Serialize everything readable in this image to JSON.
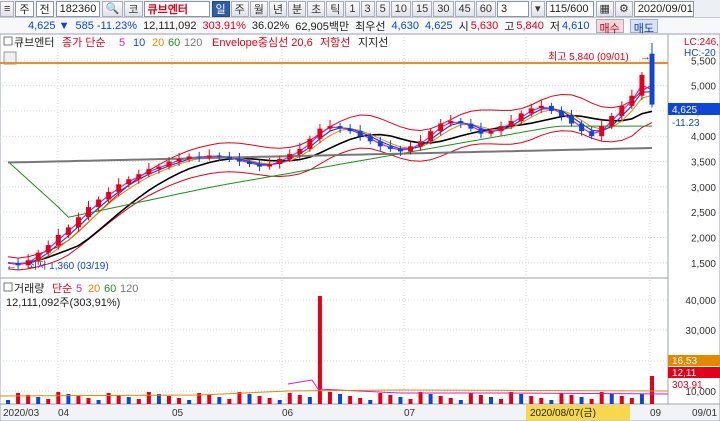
{
  "toolbar": {
    "market": "주",
    "period": "전",
    "code": "182360",
    "code_prefix": "코",
    "name": "큐브엔터",
    "tabs": [
      "일",
      "주",
      "월",
      "년",
      "분",
      "초",
      "틱"
    ],
    "active_tab": "일",
    "intervals": [
      "1",
      "3",
      "5",
      "10",
      "15",
      "30",
      "45",
      "60"
    ],
    "interval_select": "3",
    "count": "115/600",
    "date": "2020/09/01"
  },
  "quote": {
    "price": "4,625 ▼",
    "change": "585 -11.23%",
    "volume": "12,111,092",
    "vol_ratio": "303.91%",
    "turnover": "36.02%",
    "amount": "62,905백만",
    "best_ask_label": "최우선",
    "best_ask": "4,630",
    "best_bid": "4,625",
    "open_label": "시",
    "open": "5,630",
    "high_label": "고",
    "high": "5,840",
    "low_label": "저",
    "low": "4,610",
    "buy_button": "매수",
    "sell_button": "매도"
  },
  "price_panel": {
    "tag": "큐브엔터",
    "legend": {
      "ma_prefix": "종가 단순",
      "ma_periods": [
        "5",
        "10",
        "20",
        "60",
        "120"
      ],
      "envelope": "Envelope중심선 20,6",
      "resistance": "저항선",
      "support": "지지선"
    },
    "high_note": "최고 5,840 (09/01)",
    "low_note": "최저 1,360 (03/19)",
    "top_right": [
      "LC:246,",
      "HC:-20"
    ],
    "current_price": "4,625",
    "current_change": "-11.23"
  },
  "volume_panel": {
    "tag": "거래량",
    "ma_prefix": "단순",
    "ma_periods": [
      "5",
      "20",
      "60",
      "120"
    ],
    "summary": "12,111,092주(303,91%)",
    "current_badges": [
      "16,53",
      "12,11",
      "303,91"
    ]
  },
  "colors": {
    "up": "#e3001b",
    "down": "#1046d6",
    "ma5": "#d11fd1",
    "ma10": "#1f3fd8",
    "ma20": "#e08a00",
    "ma60": "#1e8f1e",
    "ma120": "#777777",
    "envelope": "#e3001b",
    "center": "#000000",
    "high_line": "#f4891f"
  },
  "chart_data": {
    "type": "candlestick",
    "price_axis": {
      "min": 1500,
      "max": 5500,
      "step": 500,
      "ticks": [
        "5,500",
        "5,000",
        "4,500",
        "4,000",
        "3,500",
        "3,000",
        "2,500",
        "2,000",
        "1,500"
      ]
    },
    "volume_axis": {
      "ticks": [
        "40,000",
        "30,000",
        "20,000",
        "10,000"
      ]
    },
    "x_labels": [
      "2020/03",
      "04",
      "05",
      "06",
      "07",
      "08",
      "09",
      "09/01"
    ],
    "highlighted_date": "2020/08/07(금)",
    "close_series": [
      1500,
      1450,
      1550,
      1700,
      1850,
      2050,
      2200,
      2400,
      2600,
      2750,
      2900,
      3050,
      3150,
      3250,
      3350,
      3400,
      3500,
      3550,
      3600,
      3580,
      3620,
      3600,
      3550,
      3500,
      3450,
      3400,
      3450,
      3550,
      3650,
      3750,
      3950,
      4150,
      4200,
      4150,
      4100,
      4000,
      3900,
      3800,
      3750,
      3700,
      3800,
      3900,
      4100,
      4250,
      4300,
      4250,
      4150,
      4050,
      4100,
      4200,
      4300,
      4450,
      4550,
      4600,
      4500,
      4400,
      4250,
      4100,
      4000,
      4200,
      4400,
      4600,
      4800,
      5210,
      4625
    ],
    "high": 5840,
    "low": 1360
  }
}
